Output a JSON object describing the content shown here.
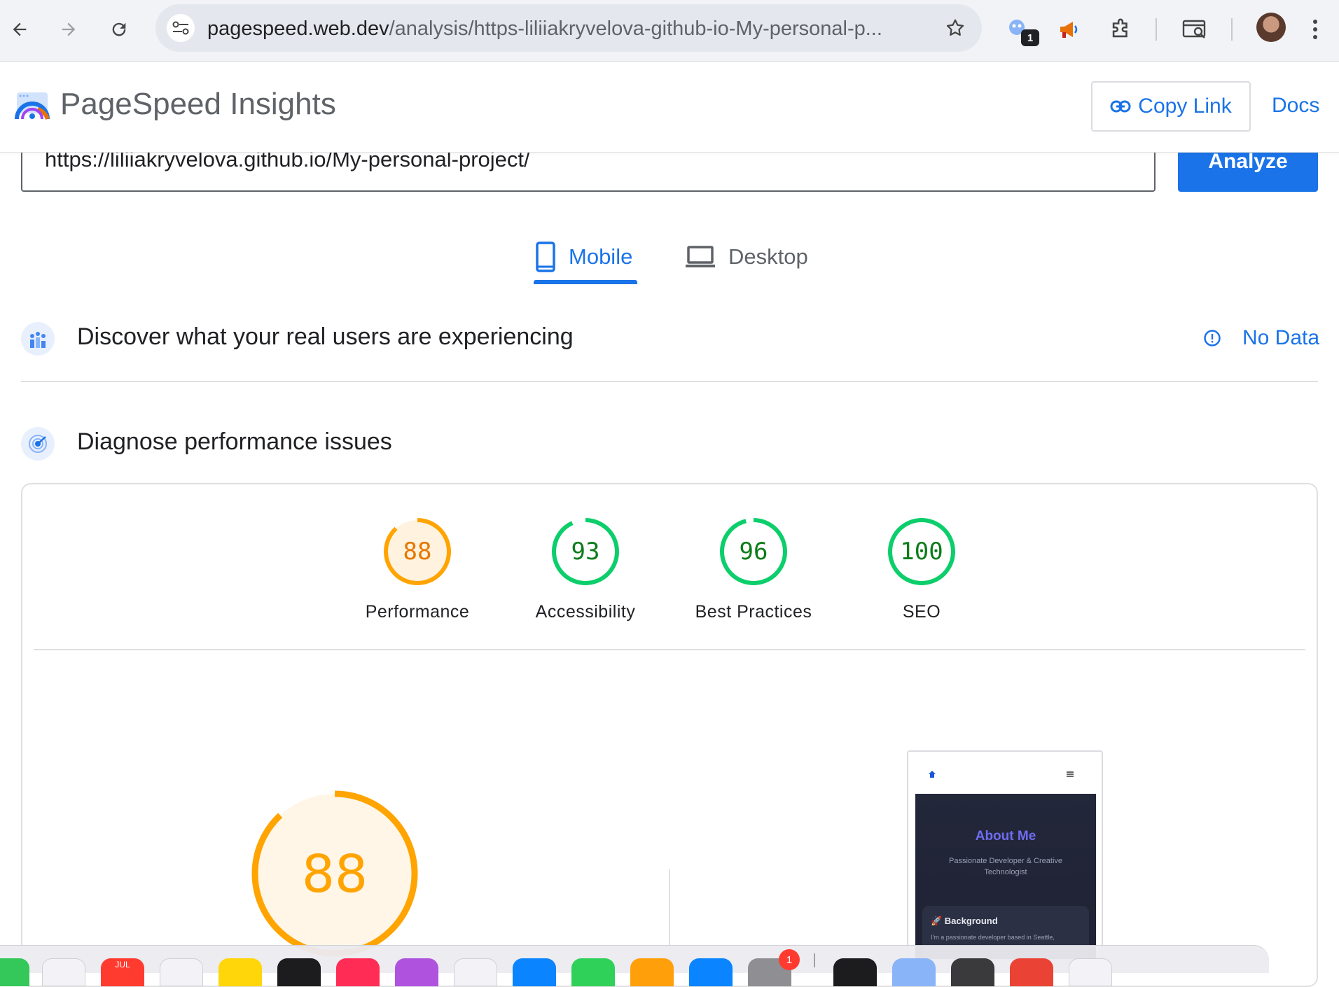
{
  "browser": {
    "url_host": "pagespeed.web.dev",
    "url_path": "/analysis/https-liliiakryvelova-github-io-My-personal-p...",
    "extension_badge": "1"
  },
  "header": {
    "app_title": "PageSpeed Insights",
    "copy_link_label": "Copy Link",
    "docs_label": "Docs"
  },
  "form": {
    "url_value": "https://liliiakryvelova.github.io/My-personal-project/",
    "analyze_label": "Analyze"
  },
  "tabs": [
    {
      "label": "Mobile",
      "active": true
    },
    {
      "label": "Desktop",
      "active": false
    }
  ],
  "field_data": {
    "title": "Discover what your real users are experiencing",
    "status": "No Data"
  },
  "lab_data": {
    "title": "Diagnose performance issues"
  },
  "scores": [
    {
      "label": "Performance",
      "score": "88",
      "value": 88,
      "color": "#e67700",
      "ring": "#ffa400",
      "fill": "#fff3e0",
      "arc": 0.88
    },
    {
      "label": "Accessibility",
      "score": "93",
      "value": 93,
      "color": "#0c7c1a",
      "ring": "#0cce6b",
      "fill": "#ffffff",
      "arc": 0.93
    },
    {
      "label": "Best Practices",
      "score": "96",
      "value": 96,
      "color": "#0c7c1a",
      "ring": "#0cce6b",
      "fill": "#ffffff",
      "arc": 0.96
    },
    {
      "label": "SEO",
      "score": "100",
      "value": 100,
      "color": "#0c7c1a",
      "ring": "#0cce6b",
      "fill": "#ffffff",
      "arc": 1.0
    }
  ],
  "big_score": {
    "score": "88",
    "value": 88,
    "color": "#ffa400"
  },
  "preview": {
    "hero_title": "About Me",
    "hero_subtitle": "Passionate Developer & Creative Technologist",
    "card_title": "🚀 Background",
    "card_text": "I'm a passionate developer based in Seattle,"
  },
  "dock": {
    "calendar_month": "JUL",
    "badge": "1"
  }
}
